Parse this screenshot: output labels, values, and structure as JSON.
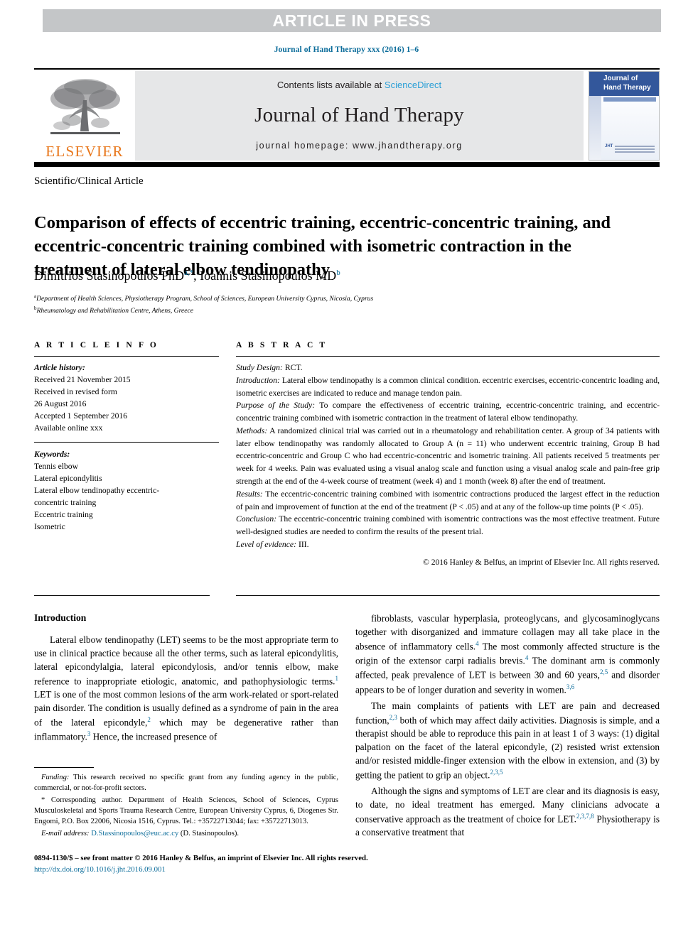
{
  "banner": {
    "text": "ARTICLE IN PRESS"
  },
  "running_head": "Journal of Hand Therapy xxx (2016) 1–6",
  "masthead": {
    "publisher": "ELSEVIER",
    "contents_prefix": "Contents lists available at ",
    "contents_link": "ScienceDirect",
    "journal_name": "Journal of Hand Therapy",
    "homepage": "journal homepage: www.jhandtherapy.org",
    "cover_title_line1": "Journal of",
    "cover_title_line2": "Hand Therapy",
    "cover_footer_mark": "JHT"
  },
  "article": {
    "type": "Scientific/Clinical Article",
    "title": "Comparison of effects of eccentric training, eccentric-concentric training, and eccentric-concentric training combined with isometric contraction in the treatment of lateral elbow tendinopathy",
    "author1": "Dimitrios Stasinopoulos PhD",
    "author1_sup": "a,*",
    "author_separator": ", ",
    "author2": "Ioannis Stasinopoulos MD",
    "author2_sup": "b",
    "affiliation_a_sup": "a",
    "affiliation_a": "Department of Health Sciences, Physiotherapy Program, School of Sciences, European University Cyprus, Nicosia, Cyprus",
    "affiliation_b_sup": "b",
    "affiliation_b": "Rheumatology and Rehabilitation Centre, Athens, Greece"
  },
  "article_info": {
    "heading": "A R T I C L E  I N F O",
    "history_label": "Article history:",
    "history": [
      "Received 21 November 2015",
      "Received in revised form",
      "26 August 2016",
      "Accepted 1 September 2016",
      "Available online xxx"
    ],
    "keywords_label": "Keywords:",
    "keywords": [
      "Tennis elbow",
      "Lateral epicondylitis",
      "Lateral elbow tendinopathy eccentric-",
      "concentric training",
      "Eccentric training",
      "Isometric"
    ]
  },
  "abstract": {
    "heading": "A B S T R A C T",
    "sections": [
      {
        "label": "Study Design:",
        "text": " RCT."
      },
      {
        "label": "Introduction:",
        "text": " Lateral elbow tendinopathy is a common clinical condition. eccentric exercises, eccentric-concentric loading and, isometric exercises are indicated to reduce and manage tendon pain."
      },
      {
        "label": "Purpose of the Study:",
        "text": " To compare the effectiveness of eccentric training, eccentric-concentric training, and eccentric-concentric training combined with isometric contraction in the treatment of lateral elbow tendinopathy."
      },
      {
        "label": "Methods:",
        "text": " A randomized clinical trial was carried out in a rheumatology and rehabilitation center. A group of 34 patients with later elbow tendinopathy was randomly allocated to Group A (n = 11) who underwent eccentric training, Group B had eccentric-concentric and Group C who had eccentric-concentric and isometric training. All patients received 5 treatments per week for 4 weeks. Pain was evaluated using a visual analog scale and function using a visual analog scale and pain-free grip strength at the end of the 4-week course of treatment (week 4) and 1 month (week 8) after the end of treatment."
      },
      {
        "label": "Results:",
        "text": " The eccentric-concentric training combined with isomentric contractions produced the largest effect in the reduction of pain and improvement of function at the end of the treatment (P < .05) and at any of the follow-up time points (P < .05)."
      },
      {
        "label": "Conclusion:",
        "text": " The eccentric-concentric training combined with isomentric contractions was the most effective treatment. Future well-designed studies are needed to confirm the results of the present trial."
      },
      {
        "label": "Level of evidence:",
        "text": " III."
      }
    ],
    "copyright": "© 2016 Hanley & Belfus, an imprint of Elsevier Inc. All rights reserved."
  },
  "body": {
    "left_heading": "Introduction",
    "left_paragraphs": [
      "Lateral elbow tendinopathy (LET) seems to be the most appropriate term to use in clinical practice because all the other terms, such as lateral epicondylitis, lateral epicondylalgia, lateral epicondylosis, and/or tennis elbow, make reference to inappropriate etiologic, anatomic, and pathophysiologic terms.@1@ LET is one of the most common lesions of the arm work-related or sport-related pain disorder. The condition is usually defined as a syndrome of pain in the area of the lateral epicondyle,@2@ which may be degenerative rather than inflammatory.@3@ Hence, the increased presence of"
    ],
    "right_paragraphs": [
      "fibroblasts, vascular hyperplasia, proteoglycans, and glycosaminoglycans together with disorganized and immature collagen may all take place in the absence of inflammatory cells.@4@ The most commonly affected structure is the origin of the extensor carpi radialis brevis.@4@ The dominant arm is commonly affected, peak prevalence of LET is between 30 and 60 years,@2,5@ and disorder appears to be of longer duration and severity in women.@3,6@",
      "The main complaints of patients with LET are pain and decreased function,@2,3@ both of which may affect daily activities. Diagnosis is simple, and a therapist should be able to reproduce this pain in at least 1 of 3 ways: (1) digital palpation on the facet of the lateral epicondyle, (2) resisted wrist extension and/or resisted middle-finger extension with the elbow in extension, and (3) by getting the patient to grip an object.@2,3,5@",
      "Although the signs and symptoms of LET are clear and its diagnosis is easy, to date, no ideal treatment has emerged. Many clinicians advocate a conservative approach as the treatment of choice for LET.@2,3,7,8@ Physiotherapy is a conservative treatment that"
    ]
  },
  "footnotes": {
    "funding_label": "Funding:",
    "funding_text": " This research received no specific grant from any funding agency in the public, commercial, or not-for-profit sectors.",
    "corresponding_text": "* Corresponding author. Department of Health Sciences, School of Sciences, Cyprus Musculoskeletal and Sports Trauma Research Centre, European University Cyprus, 6, Diogenes Str. Engomi, P.O. Box 22006, Nicosia 1516, Cyprus. Tel.: +35722713044; fax: +35722713013.",
    "email_label": "E-mail address:",
    "email_link": "D.Stassinopoulos@euc.ac.cy",
    "email_suffix": " (D. Stasinopoulos)."
  },
  "page_footer": {
    "issn_line": "0894-1130/$ – see front matter © 2016 Hanley & Belfus, an imprint of Elsevier Inc. All rights reserved.",
    "doi": "http://dx.doi.org/10.1016/j.jht.2016.09.001"
  },
  "colors": {
    "link": "#0b6c9a",
    "sciencedirect": "#2a9fd6",
    "elsevier_orange": "#e8761a",
    "cover_blue": "#33579b",
    "banner_gray": "#c4c6c8"
  }
}
